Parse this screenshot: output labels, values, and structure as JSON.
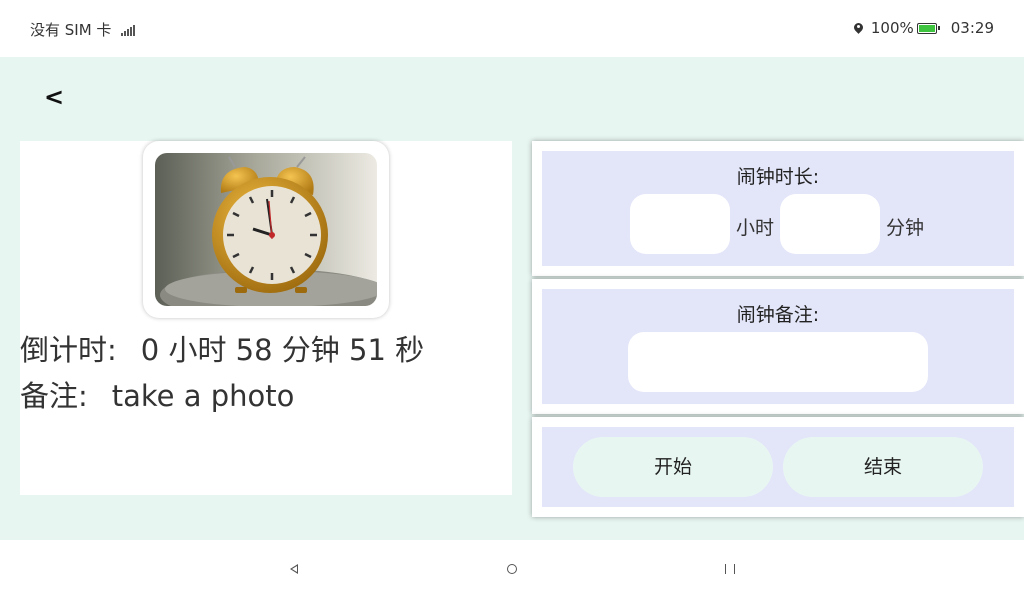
{
  "status_bar": {
    "carrier": "没有 SIM 卡",
    "battery": "100%",
    "time": "03:29",
    "icons": [
      "signal-icon",
      "location-icon",
      "battery-icon"
    ],
    "battery_color": "#3ec43e"
  },
  "header": {
    "back_label": "<"
  },
  "info": {
    "countdown_label": "倒计时:",
    "countdown_value": "0 小时 58 分钟 51 秒",
    "note_label": "备注:",
    "note_value": "take a photo"
  },
  "form": {
    "duration_title": "闹钟时长:",
    "hours_unit": "小时",
    "minutes_unit": "分钟",
    "hours_value": "",
    "minutes_value": "",
    "note_title": "闹钟备注:",
    "note_value": ""
  },
  "buttons": {
    "start_label": "开始",
    "end_label": "结束"
  },
  "nav_bar": {
    "icons": [
      "back-triangle-icon",
      "home-circle-icon",
      "recent-apps-icon"
    ]
  },
  "colors": {
    "app_background": "#e8f6f2",
    "card_fill": "#e3e5f9",
    "button_fill": "#e8f6f2"
  }
}
